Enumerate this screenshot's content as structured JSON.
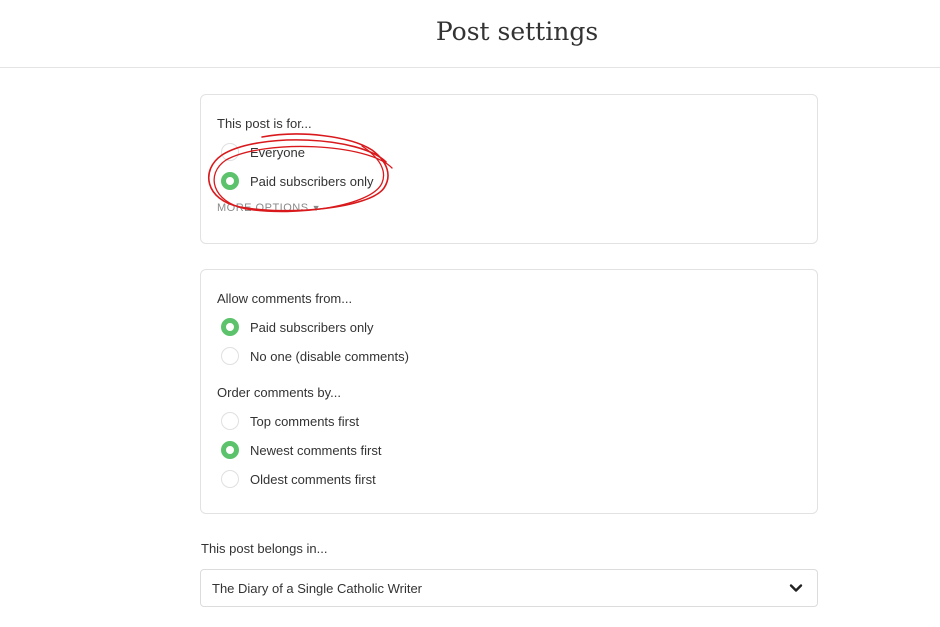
{
  "header": {
    "title": "Post settings"
  },
  "audience": {
    "label": "This post is for...",
    "options": [
      {
        "label": "Everyone",
        "checked": false
      },
      {
        "label": "Paid subscribers only",
        "checked": true
      }
    ],
    "more_options": "MORE OPTIONS"
  },
  "comments": {
    "allow_label": "Allow comments from...",
    "allow_options": [
      {
        "label": "Paid subscribers only",
        "checked": true
      },
      {
        "label": "No one (disable comments)",
        "checked": false
      }
    ],
    "order_label": "Order comments by...",
    "order_options": [
      {
        "label": "Top comments first",
        "checked": false
      },
      {
        "label": "Newest comments first",
        "checked": true
      },
      {
        "label": "Oldest comments first",
        "checked": false
      }
    ]
  },
  "section": {
    "label": "This post belongs in...",
    "selected": "The Diary of a Single Catholic Writer"
  },
  "colors": {
    "accent": "#5cc36c",
    "annotation": "#d9191c"
  }
}
